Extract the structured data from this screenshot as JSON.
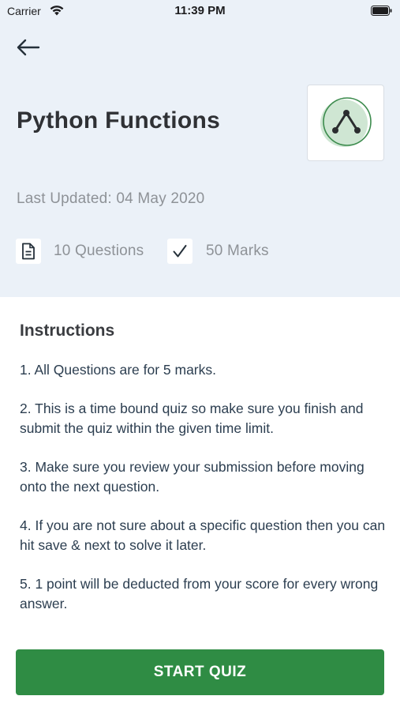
{
  "status_bar": {
    "carrier": "Carrier",
    "time": "11:39 PM"
  },
  "header": {
    "back_icon": "back-arrow-icon",
    "title": "Python Functions",
    "quiz_icon": "function-graph-icon",
    "last_updated": "Last Updated: 04 May 2020"
  },
  "stats": {
    "questions_icon": "document-icon",
    "questions": "10 Questions",
    "marks_icon": "checkmark-icon",
    "marks": "50 Marks"
  },
  "instructions": {
    "title": "Instructions",
    "items": [
      "1. All Questions are for 5 marks.",
      "2. This is a time bound quiz so make sure you finish and submit the quiz within the given time limit.",
      "3. Make sure you review your submission before moving onto the next question.",
      "4. If you are not sure about a specific question then you can hit save & next to solve it later.",
      "5. 1 point will be deducted from your score for every wrong answer."
    ]
  },
  "actions": {
    "start_label": "START QUIZ"
  },
  "colors": {
    "header_bg": "#ebf1f8",
    "accent_green": "#2f8c44",
    "icon_green_light": "#cfe6d3"
  }
}
